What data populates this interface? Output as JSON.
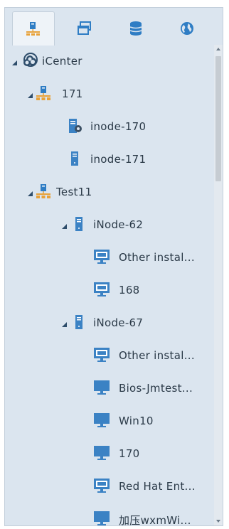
{
  "tabs": [
    {
      "icon": "network-topology-icon",
      "active": true
    },
    {
      "icon": "windows-icon",
      "active": false
    },
    {
      "icon": "database-icon",
      "active": false
    },
    {
      "icon": "globe-icon",
      "active": false
    }
  ],
  "tree": {
    "root": {
      "label": "iCenter",
      "icon": "cluster-cloud-icon",
      "expanded": true
    },
    "groups": [
      {
        "label": "171",
        "icon": "network-host-icon",
        "expanded": true,
        "children": [
          {
            "label": "inode-170",
            "icon": "server-gear-icon"
          },
          {
            "label": "inode-171",
            "icon": "server-icon"
          }
        ]
      },
      {
        "label": "Test11",
        "icon": "network-host-icon",
        "expanded": true,
        "children": [
          {
            "label": "iNode-62",
            "icon": "server-icon",
            "expanded": true,
            "vms": [
              {
                "label": "Other instal...",
                "icon": "monitor-running-icon"
              },
              {
                "label": "168",
                "icon": "monitor-running-icon"
              }
            ]
          },
          {
            "label": "iNode-67",
            "icon": "server-icon",
            "expanded": true,
            "vms": [
              {
                "label": "Other instal...",
                "icon": "monitor-running-icon"
              },
              {
                "label": "Bios-Jmtest...",
                "icon": "monitor-icon"
              },
              {
                "label": "Win10",
                "icon": "monitor-icon"
              },
              {
                "label": "170",
                "icon": "monitor-icon"
              },
              {
                "label": "Red Hat Ent...",
                "icon": "monitor-running-icon"
              },
              {
                "label": "加压wxmWi...",
                "icon": "monitor-icon"
              }
            ]
          }
        ]
      }
    ]
  },
  "colors": {
    "accent_blue": "#2f7dc4",
    "server_blue": "#3b82c4",
    "host_orange": "#e8a23a",
    "text": "#2b3a48"
  }
}
